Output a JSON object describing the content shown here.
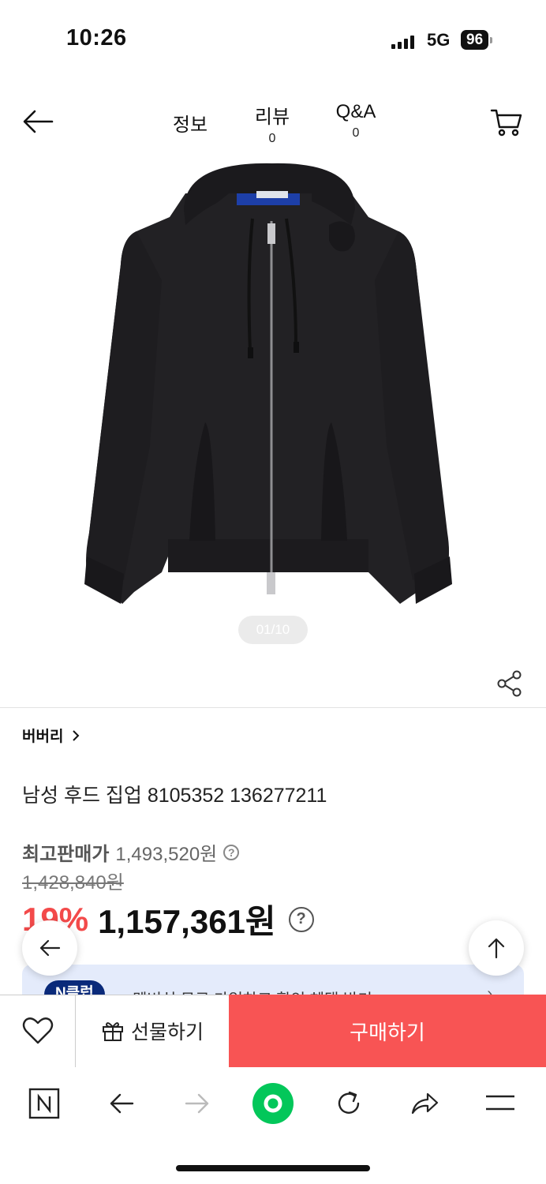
{
  "status_bar": {
    "time": "10:26",
    "network": "5G",
    "battery": "96"
  },
  "header": {
    "tabs": [
      {
        "label": "정보",
        "count": ""
      },
      {
        "label": "리뷰",
        "count": "0"
      },
      {
        "label": "Q&A",
        "count": "0"
      }
    ]
  },
  "gallery": {
    "pager": "01/10"
  },
  "product": {
    "brand": "버버리",
    "title": "남성 후드 집업 8105352 136277211",
    "max_price_label": "최고판매가",
    "max_price": "1,493,520원",
    "original_price": "1,428,840원",
    "discount": "19%",
    "sale_price": "1,157,361원"
  },
  "banner": {
    "badge": "N클럽",
    "text": "멤버십 무료 가입하고 할인 혜택 받기"
  },
  "actions": {
    "gift_label": "선물하기",
    "buy_label": "구매하기"
  },
  "colors": {
    "accent": "#f85454",
    "sale": "#f34a4a",
    "naver_green": "#03c75a",
    "banner_bg": "#e4ebfb"
  }
}
